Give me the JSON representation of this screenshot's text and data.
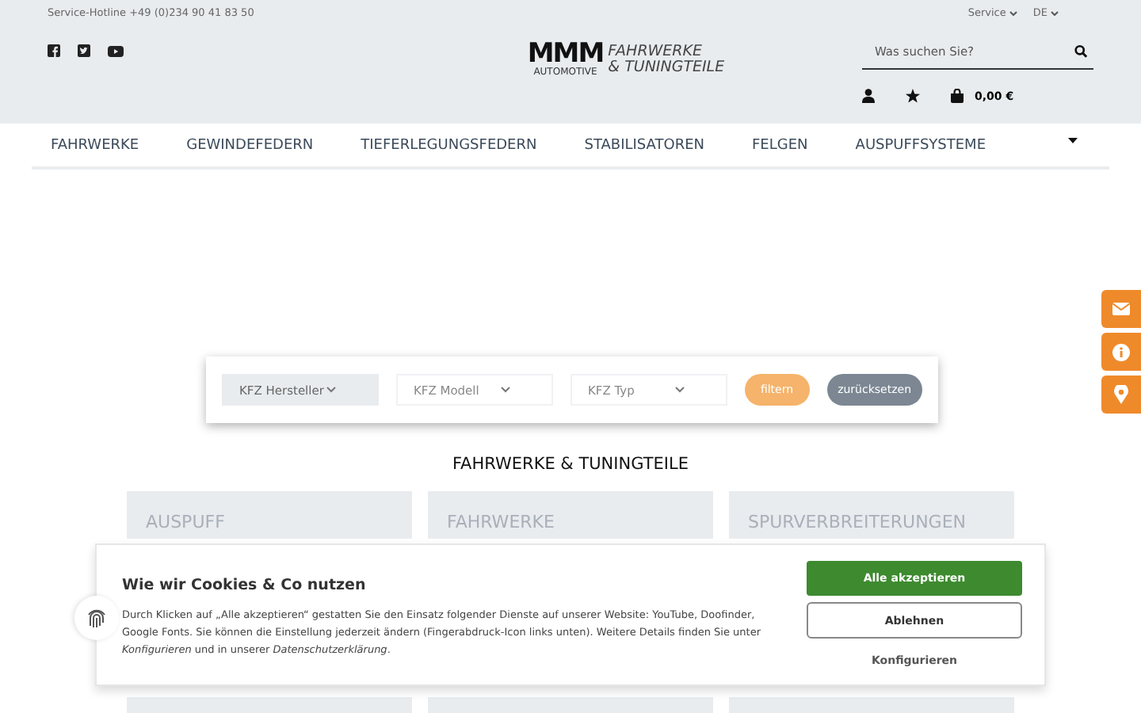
{
  "topbar": {
    "hotline": "Service-Hotline +49 (0)234 90 41 83 50",
    "menus": [
      {
        "label": "Service"
      },
      {
        "label": "DE"
      }
    ]
  },
  "logo": {
    "mark": "MMM",
    "overlay": "AUTOMOTIVE",
    "line1": "FAHRWERKE",
    "line2": "& TUNINGTEILE"
  },
  "search": {
    "placeholder": "Was suchen Sie?"
  },
  "cart": {
    "total": "0,00 €"
  },
  "nav": {
    "items": [
      "FAHRWERKE",
      "GEWINDEFEDERN",
      "TIEFERLEGUNGSFEDERN",
      "STABILISATOREN",
      "FELGEN",
      "AUSPUFFSYSTEME"
    ]
  },
  "filter": {
    "selects": [
      {
        "label": "KFZ Hersteller",
        "disabled": false
      },
      {
        "label": "KFZ Modell",
        "disabled": true
      },
      {
        "label": "KFZ Typ",
        "disabled": true
      }
    ],
    "filter_button": "filtern",
    "reset_button": "zurücksetzen"
  },
  "section": {
    "title": "FAHRWERKE & TUNINGTEILE",
    "cards": [
      {
        "label": "AUSPUFF"
      },
      {
        "label": "FAHRWERKE"
      },
      {
        "label": "SPURVERBREITERUNGEN"
      }
    ]
  },
  "cookie_dialog": {
    "title": "Wie wir Cookies & Co nutzen",
    "text": "Durch Klicken auf „Alle akzeptieren“ gestatten Sie den Einsatz folgender Dienste auf unserer Website: YouTube, Doofinder, Google Fonts. Sie können die Einstellung jederzeit ändern (Fingerabdruck-Icon links unten). Weitere Details finden Sie unter *Konfigurieren* und in unserer *Datenschutzerklärung*.",
    "accept_button": "Alle akzeptieren",
    "decline_button": "Ablehnen",
    "configure_button": "Konfigurieren"
  }
}
